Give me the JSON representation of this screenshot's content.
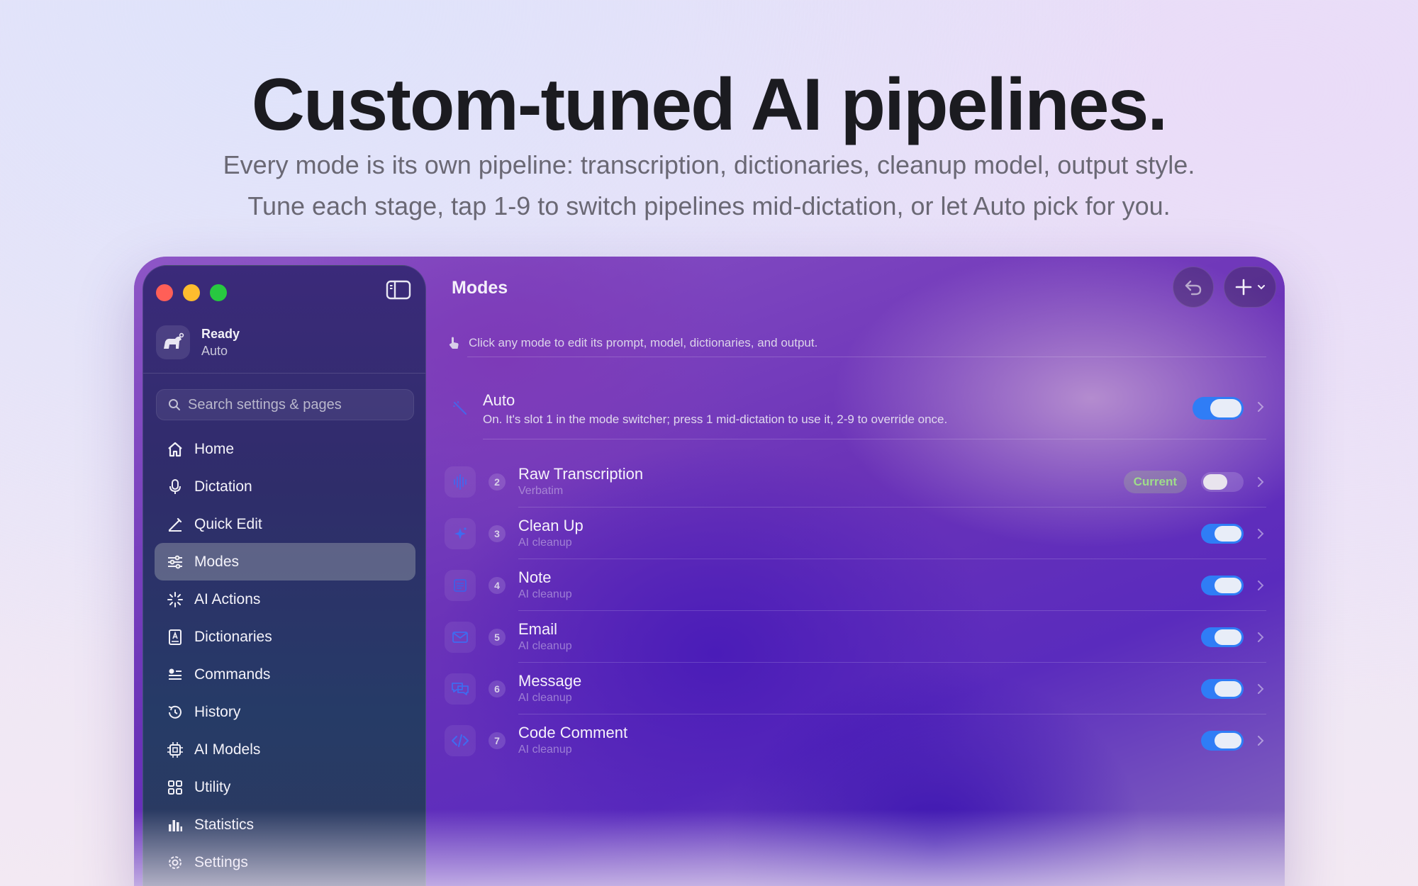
{
  "hero": {
    "title": "Custom-tuned AI pipelines.",
    "subtitle_line1": "Every mode is its own pipeline: transcription, dictionaries, cleanup model, output style.",
    "subtitle_line2": "Tune each stage, tap 1-9 to switch pipelines mid-dictation, or let Auto pick for you."
  },
  "sidebar": {
    "status_title": "Ready",
    "status_sub": "Auto",
    "search_placeholder": "Search settings & pages",
    "items": [
      {
        "label": "Home",
        "icon": "home-icon"
      },
      {
        "label": "Dictation",
        "icon": "microphone-icon"
      },
      {
        "label": "Quick Edit",
        "icon": "pencil-icon"
      },
      {
        "label": "Modes",
        "icon": "sliders-icon",
        "active": true
      },
      {
        "label": "AI Actions",
        "icon": "sparkle-icon"
      },
      {
        "label": "Dictionaries",
        "icon": "dictionary-icon"
      },
      {
        "label": "Commands",
        "icon": "commands-icon"
      },
      {
        "label": "History",
        "icon": "history-icon"
      },
      {
        "label": "AI Models",
        "icon": "chip-icon"
      },
      {
        "label": "Utility",
        "icon": "grid-icon"
      },
      {
        "label": "Statistics",
        "icon": "bar-chart-icon"
      },
      {
        "label": "Settings",
        "icon": "gear-icon"
      }
    ]
  },
  "main": {
    "title": "Modes",
    "hint": "Click any mode to edit its prompt, model, dictionaries, and output.",
    "auto": {
      "name": "Auto",
      "description": "On. It's slot 1 in the mode switcher; press 1 mid-dictation to use it, 2-9 to override once.",
      "enabled": true
    },
    "modes": [
      {
        "num": "2",
        "name": "Raw Transcription",
        "sub": "Verbatim",
        "icon": "waveform-icon",
        "badge": "Current",
        "enabled": false
      },
      {
        "num": "3",
        "name": "Clean Up",
        "sub": "AI cleanup",
        "icon": "sparkle-icon",
        "enabled": true
      },
      {
        "num": "4",
        "name": "Note",
        "sub": "AI cleanup",
        "icon": "note-icon",
        "enabled": true
      },
      {
        "num": "5",
        "name": "Email",
        "sub": "AI cleanup",
        "icon": "envelope-icon",
        "enabled": true
      },
      {
        "num": "6",
        "name": "Message",
        "sub": "AI cleanup",
        "icon": "chat-bubbles-icon",
        "enabled": true
      },
      {
        "num": "7",
        "name": "Code Comment",
        "sub": "AI cleanup",
        "icon": "code-icon",
        "enabled": true
      }
    ]
  },
  "colors": {
    "accent": "#2f7df6",
    "badge_text": "#9fdc8a",
    "traffic_red": "#ff5f57",
    "traffic_yellow": "#febc2e",
    "traffic_green": "#28c840"
  }
}
